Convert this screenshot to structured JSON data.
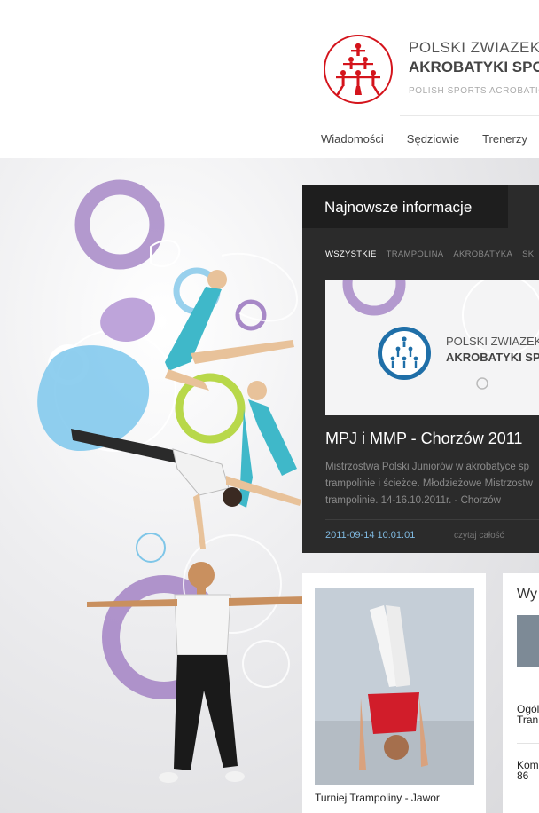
{
  "header": {
    "org_name_line1": "POLSKI ZWIAZEK",
    "org_name_line2": "AKROBATYKI SPO",
    "org_name_line3": "POLISH SPORTS ACROBATICS",
    "brand_color": "#d4141c"
  },
  "nav": {
    "items": [
      "Wiadomości",
      "Sędziowie",
      "Trenerzy"
    ]
  },
  "news": {
    "title": "Najnowsze informacje",
    "filters": [
      "WSZYSTKIE",
      "TRAMPOLINA",
      "AKROBATYKA",
      "SK"
    ],
    "active_filter": "WSZYSTKIE",
    "image_text_1": "POLSKI ZWIAZEK",
    "image_text_2": "AKROBATYKI SPO",
    "headline": "MPJ i MMP - Chorzów 2011",
    "excerpt_lines": [
      "Mistrzostwa Polski Juniorów w akrobatyce sp",
      "trampolinie i ścieżce. Młodzieżowe Mistrzostw",
      "trampolinie. 14-16.10.2011r. - Chorzów"
    ],
    "date": "2011-09-14 10:01:01",
    "read_more": "czytaj całość",
    "date_color": "#7fb9e0"
  },
  "cards": {
    "card1_caption": "Turniej Trampoliny - Jawor",
    "card2_title": "Wy",
    "card2_line1": [
      "Ogól",
      "Tran"
    ],
    "card2_line2": [
      "Kom",
      "86"
    ]
  },
  "decor": {
    "purple": "#a788c7",
    "lightblue": "#7fc6e8",
    "lime": "#b8d84a"
  }
}
